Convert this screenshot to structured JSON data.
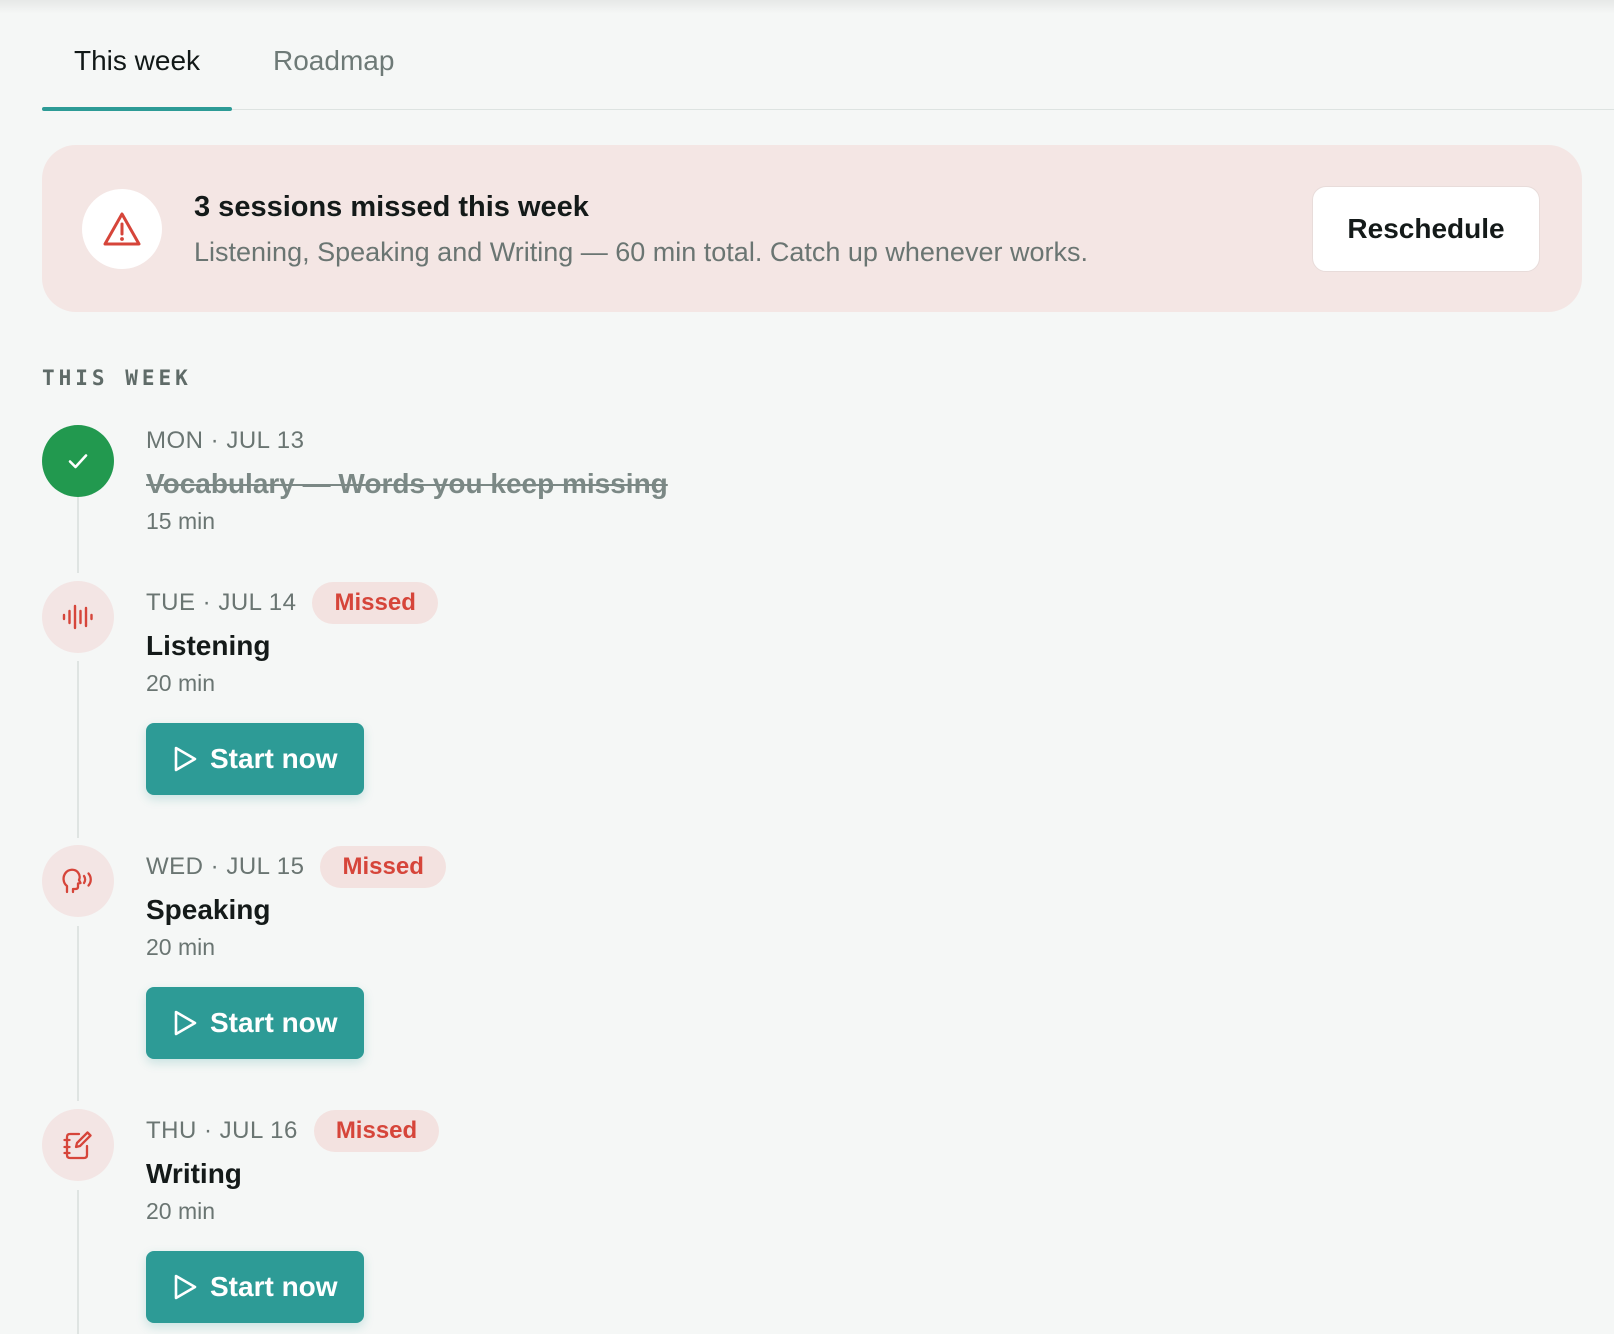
{
  "tabs": [
    {
      "label": "This week",
      "active": true
    },
    {
      "label": "Roadmap",
      "active": false
    }
  ],
  "alert": {
    "title": "3 sessions missed this week",
    "subtitle": "Listening, Speaking and Writing — 60 min total. Catch up whenever works.",
    "button_label": "Reschedule",
    "icon": "warning-triangle-icon"
  },
  "section_label": "THIS WEEK",
  "sessions": [
    {
      "day": "MON · JUL 13",
      "title": "Vocabulary — Words you keep missing",
      "duration": "15 min",
      "status": "done",
      "icon": "check-icon"
    },
    {
      "day": "TUE · JUL 14",
      "badge": "Missed",
      "title": "Listening",
      "duration": "20 min",
      "status": "missed",
      "icon": "audio-wave-icon",
      "action": "Start now"
    },
    {
      "day": "WED · JUL 15",
      "badge": "Missed",
      "title": "Speaking",
      "duration": "20 min",
      "status": "missed",
      "icon": "speaking-head-icon",
      "action": "Start now"
    },
    {
      "day": "THU · JUL 16",
      "badge": "Missed",
      "title": "Writing",
      "duration": "20 min",
      "status": "missed",
      "icon": "notepad-pen-icon",
      "action": "Start now"
    }
  ],
  "colors": {
    "accent": "#2d9b96",
    "danger": "#d6453a",
    "success": "#22994f",
    "alert_bg": "#f4e6e4"
  }
}
